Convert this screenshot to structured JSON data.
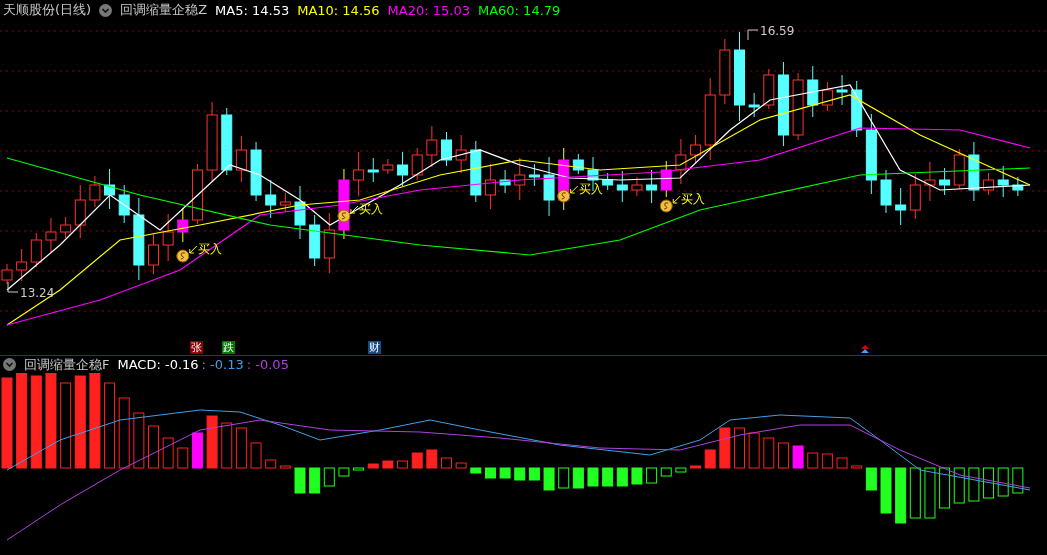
{
  "header": {
    "stock": "天顺股份(日线)",
    "indicator": "回调缩量企稳Z",
    "averages": [
      {
        "label": "MA5: 14.53",
        "color": "#ffffff"
      },
      {
        "label": "MA10: 14.56",
        "color": "#ffff00"
      },
      {
        "label": "MA20: 15.03",
        "color": "#ff00ff"
      },
      {
        "label": "MA60: 14.79",
        "color": "#00ff00"
      }
    ]
  },
  "price_chart": {
    "high_label": "16.59",
    "low_label": "13.24",
    "signals": [
      {
        "label": "买入"
      },
      {
        "label": "买入"
      },
      {
        "label": "买入"
      },
      {
        "label": "买入"
      }
    ]
  },
  "event_tags": [
    {
      "label": "张",
      "color": "#8b0000"
    },
    {
      "label": "跌",
      "color": "#007a00"
    },
    {
      "label": "财",
      "color": "#184a84"
    }
  ],
  "macd_header": {
    "indicator": "回调缩量企稳F",
    "values": [
      {
        "label": "MACD: -0.16",
        "color": "#ffffff"
      },
      {
        "label": ": -0.13",
        "color": "#3fa0e8"
      },
      {
        "label": ": -0.05",
        "color": "#b040e0"
      }
    ]
  }
}
